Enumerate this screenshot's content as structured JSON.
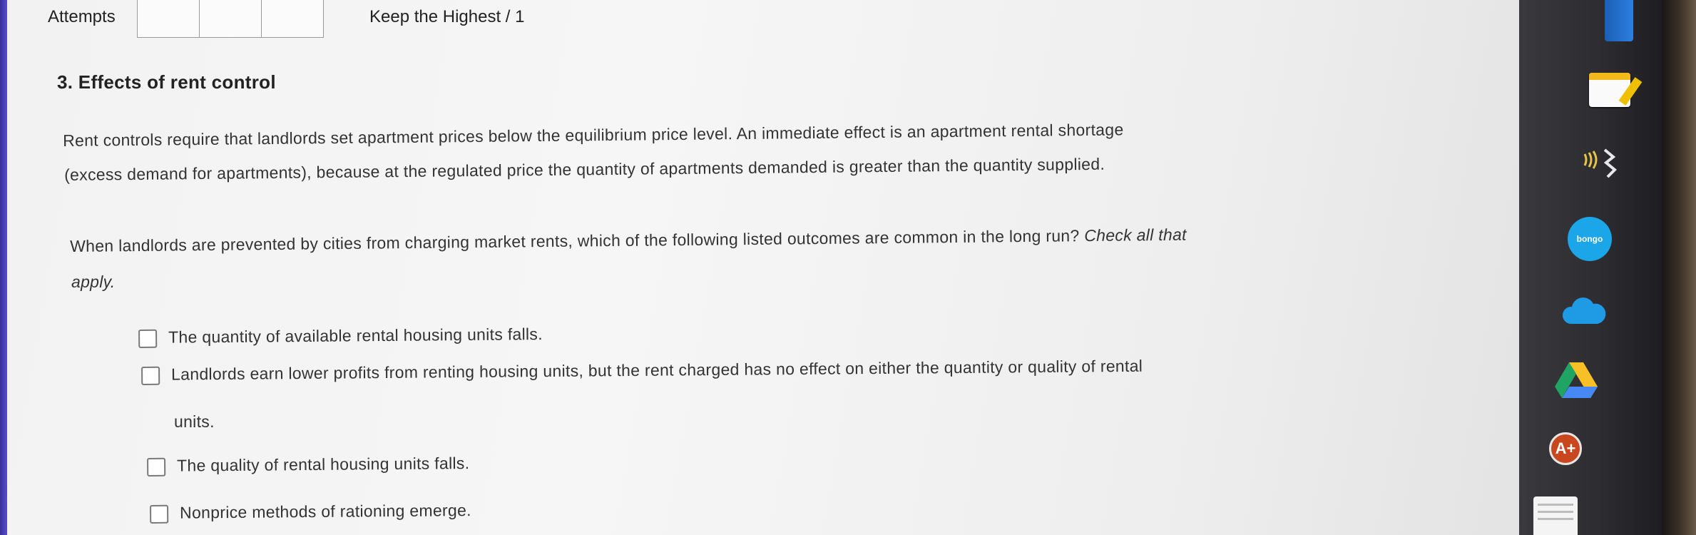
{
  "header": {
    "attempts_label": "Attempts",
    "keep_highest": "Keep the Highest / 1"
  },
  "question": {
    "title": "3. Effects of rent control",
    "intro_line1": "Rent controls require that landlords set apartment prices below the equilibrium price level. An immediate effect is an apartment rental shortage",
    "intro_line2": "(excess demand for apartments), because at the regulated price the quantity of apartments demanded is greater than the quantity supplied.",
    "prompt_line1": "When landlords are prevented by cities from charging market rents, which of the following listed outcomes are common in the long run?",
    "prompt_italic1": "Check all that",
    "prompt_italic2": "apply."
  },
  "options": [
    {
      "label": "The quantity of available rental housing units falls.",
      "checked": false
    },
    {
      "label": "Landlords earn lower profits from renting housing units, but the rent charged has no effect on either the quantity or quality of rental",
      "label_cont": "units.",
      "checked": false
    },
    {
      "label": "The quality of rental housing units falls.",
      "checked": false
    },
    {
      "label": "Nonprice methods of rationing emerge.",
      "checked": false
    }
  ],
  "dock": {
    "bongo_label": "bongo",
    "aplus_label": "A+",
    "icons": [
      "book-icon",
      "notes-icon",
      "sound-icon",
      "bongo-icon",
      "cloud-icon",
      "drive-icon",
      "aplus-icon",
      "page-icon"
    ],
    "colors": {
      "bongo": "#1aa6e8",
      "cloud": "#1e9be4",
      "aplus": "#c8471e"
    }
  }
}
